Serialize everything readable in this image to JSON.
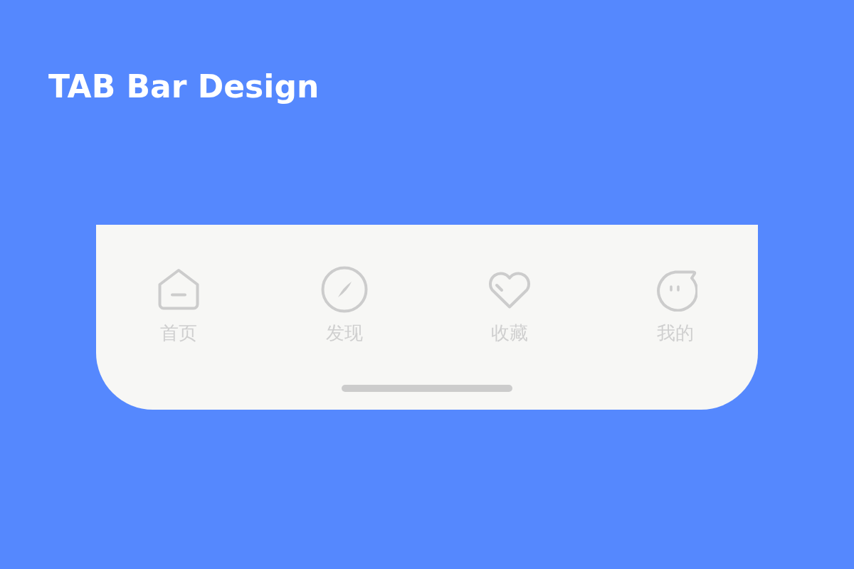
{
  "title": "TAB Bar Design",
  "tab_bar": {
    "tabs": [
      {
        "label": "首页"
      },
      {
        "label": "发现"
      },
      {
        "label": "收藏"
      },
      {
        "label": "我的"
      }
    ]
  }
}
